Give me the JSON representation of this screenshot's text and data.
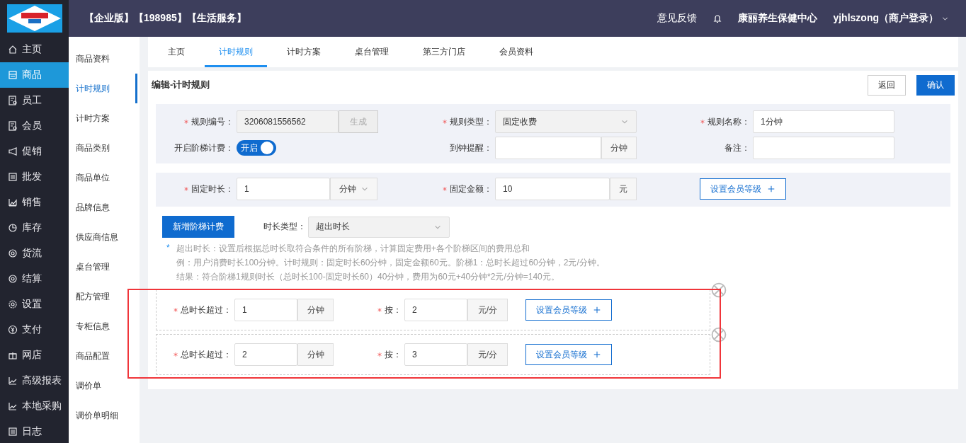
{
  "header": {
    "edition": "【企业版】【198985】【生活服务】",
    "feedback": "意见反馈",
    "store": "康丽养生保健中心",
    "user": "yjhlszong（商户登录）"
  },
  "nav": {
    "items": [
      {
        "label": "主页",
        "selected": false
      },
      {
        "label": "商品",
        "selected": true
      },
      {
        "label": "员工",
        "selected": false
      },
      {
        "label": "会员",
        "selected": false
      },
      {
        "label": "促销",
        "selected": false
      },
      {
        "label": "批发",
        "selected": false
      },
      {
        "label": "销售",
        "selected": false
      },
      {
        "label": "库存",
        "selected": false
      },
      {
        "label": "货流",
        "selected": false
      },
      {
        "label": "结算",
        "selected": false
      },
      {
        "label": "设置",
        "selected": false
      },
      {
        "label": "支付",
        "selected": false
      },
      {
        "label": "网店",
        "selected": false
      },
      {
        "label": "高级报表",
        "selected": false
      },
      {
        "label": "本地采购",
        "selected": false
      },
      {
        "label": "日志",
        "selected": false
      }
    ]
  },
  "subnav": {
    "items": [
      {
        "label": "商品资料",
        "selected": false
      },
      {
        "label": "计时规则",
        "selected": true
      },
      {
        "label": "计时方案",
        "selected": false
      },
      {
        "label": "商品类别",
        "selected": false
      },
      {
        "label": "商品单位",
        "selected": false
      },
      {
        "label": "品牌信息",
        "selected": false
      },
      {
        "label": "供应商信息",
        "selected": false
      },
      {
        "label": "桌台管理",
        "selected": false
      },
      {
        "label": "配方管理",
        "selected": false
      },
      {
        "label": "专柜信息",
        "selected": false
      },
      {
        "label": "商品配置",
        "selected": false
      },
      {
        "label": "调价单",
        "selected": false
      },
      {
        "label": "调价单明细",
        "selected": false
      }
    ]
  },
  "tabs": [
    {
      "label": "主页",
      "selected": false
    },
    {
      "label": "计时规则",
      "selected": true
    },
    {
      "label": "计时方案",
      "selected": false
    },
    {
      "label": "桌台管理",
      "selected": false
    },
    {
      "label": "第三方门店",
      "selected": false
    },
    {
      "label": "会员资料",
      "selected": false
    }
  ],
  "page_title": "编辑-计时规则",
  "buttons": {
    "back": "返回",
    "confirm": "确认"
  },
  "form": {
    "rule_number": {
      "label": "规则编号：",
      "required": true,
      "value": "3206081556562",
      "button": "生成"
    },
    "rule_type": {
      "label": "规则类型：",
      "required": true,
      "value": "固定收费"
    },
    "rule_name": {
      "label": "规则名称：",
      "required": true,
      "value": "1分钟"
    },
    "tiered_billing": {
      "label": "开启阶梯计费：",
      "on": true,
      "switch_label": "开启"
    },
    "reminder": {
      "label": "到钟提醒：",
      "unit": "分钟"
    },
    "remark": {
      "label": "备注："
    },
    "fixed_duration": {
      "label": "固定时长：",
      "required": true,
      "value": "1",
      "unit": "分钟"
    },
    "fixed_amount": {
      "label": "固定金额：",
      "required": true,
      "value": "10",
      "unit": "元"
    },
    "member_level_button": "设置会员等级"
  },
  "add_tier_button": "新增阶梯计费",
  "duration_type": {
    "label": "时长类型：",
    "value": "超出时长"
  },
  "notes": {
    "marker": "*",
    "lines": [
      "超出时长：设置后根据总时长取符合条件的所有阶梯，计算固定费用+各个阶梯区间的费用总和",
      "例：用户消费时长100分钟。计时规则：固定时长60分钟，固定金额60元。阶梯1：总时长超过60分钟，2元/分钟。",
      "结果：符合阶梯1规则时长（总时长100-固定时长60）40分钟，费用为60元+40分钟*2元/分钟=140元。"
    ]
  },
  "tiers": [
    {
      "label": "总时长超过：",
      "required": true,
      "value": "1",
      "unit": "分钟",
      "rate_label": "按：",
      "rate_value": "2",
      "rate_unit": "元/分",
      "member_button": "设置会员等级"
    },
    {
      "label": "总时长超过：",
      "required": true,
      "value": "2",
      "unit": "分钟",
      "rate_label": "按：",
      "rate_value": "3",
      "rate_unit": "元/分",
      "member_button": "设置会员等级"
    }
  ]
}
